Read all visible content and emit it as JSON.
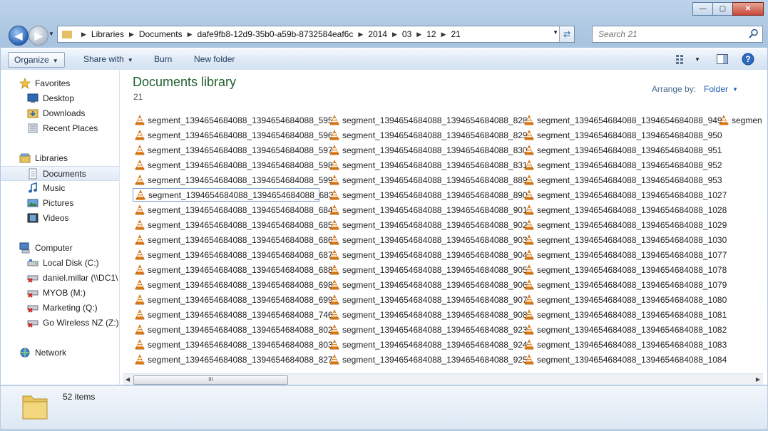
{
  "window": {
    "minimize_glyph": "—",
    "maximize_glyph": "▢",
    "close_glyph": "✕"
  },
  "address_bar": {
    "crumbs": [
      "Libraries",
      "Documents",
      "dafe9fb8-12d9-35b0-a59b-8732584eaf6c",
      "2014",
      "03",
      "12",
      "21"
    ]
  },
  "search": {
    "placeholder": "Search 21"
  },
  "toolbar": {
    "organize": "Organize",
    "share_with": "Share with",
    "burn": "Burn",
    "new_folder": "New folder"
  },
  "sidebar": {
    "favorites": "Favorites",
    "desktop": "Desktop",
    "downloads": "Downloads",
    "recent_places": "Recent Places",
    "libraries": "Libraries",
    "documents": "Documents",
    "music": "Music",
    "pictures": "Pictures",
    "videos": "Videos",
    "computer": "Computer",
    "local_disk": "Local Disk (C:)",
    "drive_daniel": "daniel.millar (\\\\DC1\\",
    "drive_myob": "MYOB (M:)",
    "drive_marketing": "Marketing (Q:)",
    "drive_gowireless": "Go Wireless NZ (Z:)",
    "network": "Network"
  },
  "content": {
    "title": "Documents library",
    "subtitle": "21",
    "arrange_label": "Arrange by:",
    "arrange_value": "Folder",
    "files": [
      [
        "segment_1394654684088_1394654684088_595",
        "segment_1394654684088_1394654684088_596",
        "segment_1394654684088_1394654684088_597",
        "segment_1394654684088_1394654684088_598",
        "segment_1394654684088_1394654684088_599",
        "segment_1394654684088_1394654684088_683",
        "segment_1394654684088_1394654684088_684",
        "segment_1394654684088_1394654684088_685",
        "segment_1394654684088_1394654684088_686",
        "segment_1394654684088_1394654684088_687",
        "segment_1394654684088_1394654684088_688",
        "segment_1394654684088_1394654684088_698",
        "segment_1394654684088_1394654684088_699",
        "segment_1394654684088_1394654684088_746",
        "segment_1394654684088_1394654684088_802",
        "segment_1394654684088_1394654684088_803",
        "segment_1394654684088_1394654684088_827"
      ],
      [
        "segment_1394654684088_1394654684088_828",
        "segment_1394654684088_1394654684088_829",
        "segment_1394654684088_1394654684088_830",
        "segment_1394654684088_1394654684088_831",
        "segment_1394654684088_1394654684088_889",
        "segment_1394654684088_1394654684088_890",
        "segment_1394654684088_1394654684088_901",
        "segment_1394654684088_1394654684088_902",
        "segment_1394654684088_1394654684088_903",
        "segment_1394654684088_1394654684088_904",
        "segment_1394654684088_1394654684088_905",
        "segment_1394654684088_1394654684088_906",
        "segment_1394654684088_1394654684088_907",
        "segment_1394654684088_1394654684088_908",
        "segment_1394654684088_1394654684088_923",
        "segment_1394654684088_1394654684088_924",
        "segment_1394654684088_1394654684088_925"
      ],
      [
        "segment_1394654684088_1394654684088_949",
        "segment_1394654684088_1394654684088_950",
        "segment_1394654684088_1394654684088_951",
        "segment_1394654684088_1394654684088_952",
        "segment_1394654684088_1394654684088_953",
        "segment_1394654684088_1394654684088_1027",
        "segment_1394654684088_1394654684088_1028",
        "segment_1394654684088_1394654684088_1029",
        "segment_1394654684088_1394654684088_1030",
        "segment_1394654684088_1394654684088_1077",
        "segment_1394654684088_1394654684088_1078",
        "segment_1394654684088_1394654684088_1079",
        "segment_1394654684088_1394654684088_1080",
        "segment_1394654684088_1394654684088_1081",
        "segment_1394654684088_1394654684088_1082",
        "segment_1394654684088_1394654684088_1083",
        "segment_1394654684088_1394654684088_1084"
      ],
      [
        "segmen"
      ]
    ],
    "focused_file": "segment_1394654684088_1394654684088_683",
    "file_icon": "vlc-cone-icon"
  },
  "scrollbar": {
    "thumb_grip": "III"
  },
  "details": {
    "item_count": "52 items"
  }
}
